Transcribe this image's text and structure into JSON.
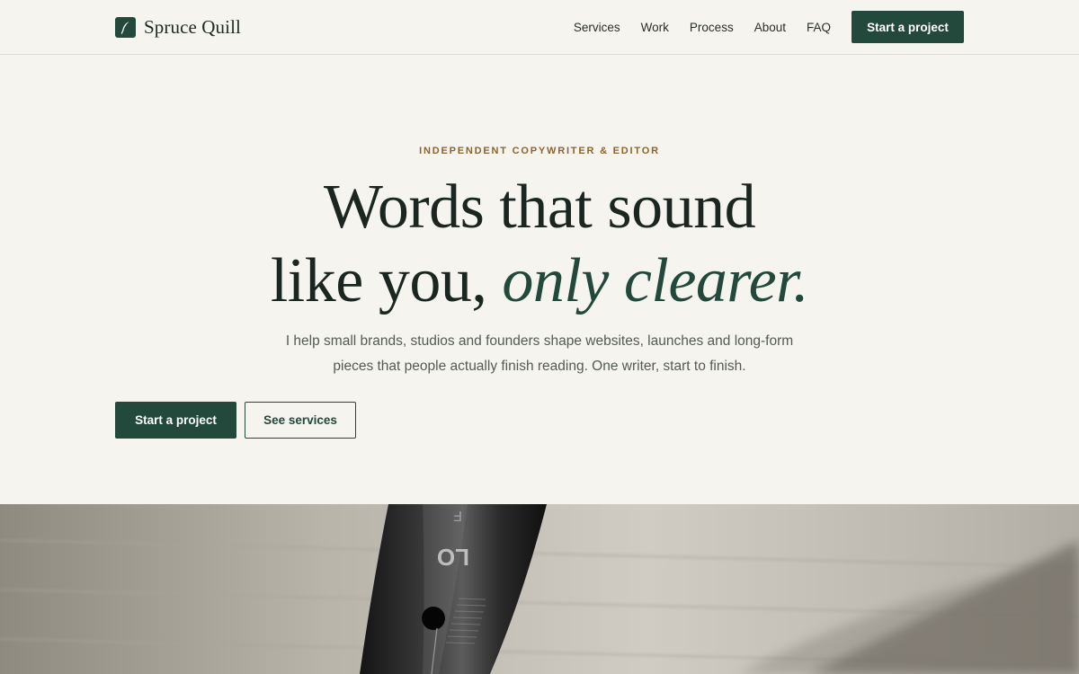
{
  "brand": {
    "name": "Spruce Quill",
    "icon": "quill-icon"
  },
  "nav": {
    "items": [
      "Services",
      "Work",
      "Process",
      "About",
      "FAQ"
    ],
    "cta_label": "Start a project"
  },
  "hero": {
    "eyebrow": "INDEPENDENT COPYWRITER & EDITOR",
    "headline_line1": "Words that sound",
    "headline_line2_plain": "like you,",
    "headline_line2_accent": "only clearer.",
    "subhead": "I help small brands, studios and founders shape websites, launches and long-form pieces that people actually finish reading. One writer, start to finish.",
    "primary_button": "Start a project",
    "secondary_button": "See services"
  },
  "photo": {
    "subject": "fountain-pen-nib"
  },
  "colors": {
    "background": "#f6f4ef",
    "brand_green": "#22493c",
    "eyebrow_gold": "#8a6430",
    "text_dark": "#1b2620"
  }
}
